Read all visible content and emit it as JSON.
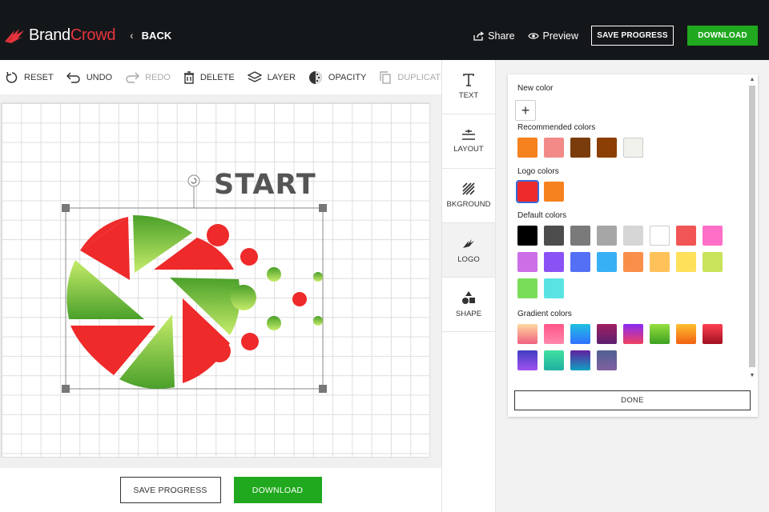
{
  "header": {
    "brand_part1": "Brand",
    "brand_part2": "Crowd",
    "back_label": "BACK",
    "share_label": "Share",
    "preview_label": "Preview",
    "save_progress_label": "SAVE PROGRESS",
    "download_label": "DOWNLOAD"
  },
  "toolbar": {
    "reset": "RESET",
    "undo": "UNDO",
    "redo": "REDO",
    "delete": "DELETE",
    "layer": "LAYER",
    "opacity": "OPACITY",
    "duplicate": "DUPLICATE"
  },
  "canvas": {
    "logo_text": "START"
  },
  "bottom": {
    "save_progress_label": "SAVE PROGRESS",
    "download_label": "DOWNLOAD"
  },
  "sidenav": {
    "text": "TEXT",
    "layout": "LAYOUT",
    "background": "BKGROUND",
    "logo": "LOGO",
    "shape": "SHAPE",
    "active": "LOGO"
  },
  "color_panel": {
    "new_color_title": "New color",
    "add_symbol": "+",
    "recommended_title": "Recommended colors",
    "recommended": [
      "#f5821f",
      "#f28b88",
      "#7a3c0a",
      "#8b3f02",
      "#f2f2ed"
    ],
    "logo_colors_title": "Logo colors",
    "logo_colors": [
      "#ee2a2a",
      "#f5821f"
    ],
    "selected_logo_color": "#ee2a2a",
    "default_title": "Default colors",
    "default_colors": [
      "#000000",
      "#4d4d4d",
      "#7a7a7a",
      "#a6a6a6",
      "#d6d6d6",
      "#ffffff",
      "#f25555",
      "#ff6fc8",
      "#cc6ee6",
      "#8a52f5",
      "#5470f5",
      "#38b0f5",
      "#fa8f4a",
      "#ffc25a",
      "#ffe05a",
      "#c9e35a",
      "#7add5a",
      "#5ae3e3"
    ],
    "gradient_title": "Gradient colors",
    "gradient_colors": [
      [
        "#ffd9a0",
        "#f06080"
      ],
      [
        "#ff5588",
        "#ff88aa"
      ],
      [
        "#20c0e0",
        "#3070ff"
      ],
      [
        "#a02060",
        "#5a2070"
      ],
      [
        "#8a2af5",
        "#f04060"
      ],
      [
        "#96e040",
        "#3ca020"
      ],
      [
        "#ffc030",
        "#f06010"
      ],
      [
        "#ff4050",
        "#a01020"
      ],
      [
        "#4040c0",
        "#a050f0"
      ],
      [
        "#40e0a0",
        "#20b0a0"
      ],
      [
        "#6020a0",
        "#10a0c0"
      ],
      [
        "#506090",
        "#8060a0"
      ]
    ],
    "done_label": "DONE"
  }
}
